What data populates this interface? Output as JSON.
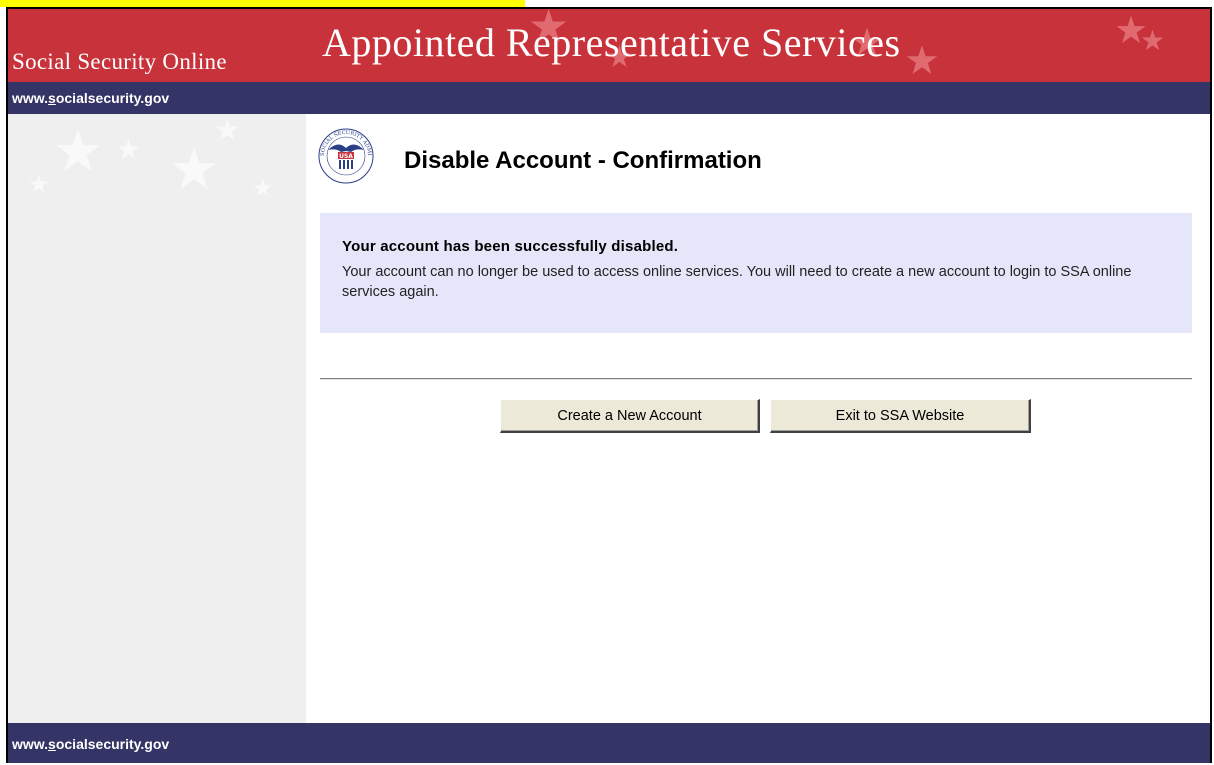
{
  "header": {
    "site_name": "Social Security Online",
    "service_title": "Appointed Representative Services",
    "url_prefix": "www.",
    "url_underlined": "s",
    "url_rest": "ocialsecurity.gov"
  },
  "page": {
    "title": "Disable Account - Confirmation",
    "seal_text": "SOCIAL SECURITY ADMINISTRATION",
    "seal_shield": "USA"
  },
  "message": {
    "heading": "Your account has been successfully disabled.",
    "body": "Your account can no longer be used to access online services.  You will need to create a new account to login to SSA online services again."
  },
  "actions": {
    "create_account": "Create a New Account",
    "exit_site": "Exit to SSA Website"
  },
  "footer": {
    "url_prefix": "www.",
    "url_underlined": "s",
    "url_rest": "ocialsecurity.gov"
  },
  "colors": {
    "banner_red": "#c8323a",
    "navy": "#343466",
    "message_bg": "#e6e6fa",
    "sidebar_bg": "#efefef",
    "highlight": "#ffff00"
  },
  "icons": [
    "ssa-seal-icon",
    "star-icon"
  ]
}
